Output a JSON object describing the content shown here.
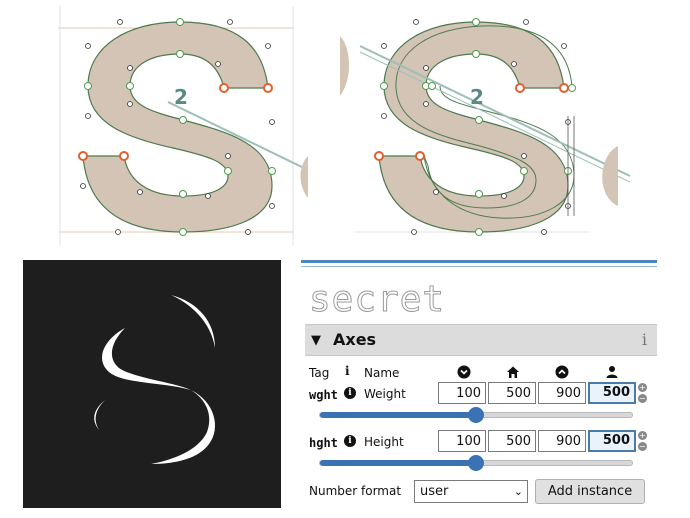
{
  "preview": {
    "text": "secret"
  },
  "axes_panel": {
    "title": "Axes",
    "info_glyph": "i",
    "columns": {
      "tag": "Tag",
      "info": "i",
      "name": "Name"
    },
    "column_icons": [
      "chevron-down-circle-icon",
      "home-icon",
      "chevron-up-circle-icon",
      "user-icon"
    ],
    "axes": [
      {
        "tag": "wght",
        "name": "Weight",
        "min": "100",
        "default": "500",
        "max": "900",
        "user": "500",
        "slider_fraction": 0.5
      },
      {
        "tag": "hght",
        "name": "Height",
        "min": "100",
        "default": "500",
        "max": "900",
        "user": "500",
        "slider_fraction": 0.5
      }
    ],
    "number_format_label": "Number format",
    "number_format_value": "user",
    "add_instance_label": "Add instance"
  },
  "glyph_labels": {
    "left_number": "2",
    "right_number": "2"
  },
  "colors": {
    "glyph_fill": "#d3c4b5",
    "glyph_outline": "#4e7a4e",
    "guide_line": "#9dbfb7",
    "accent_blue": "#3a72b4",
    "dark_bg": "#1e1e1e",
    "selected_node": "#e06030"
  }
}
